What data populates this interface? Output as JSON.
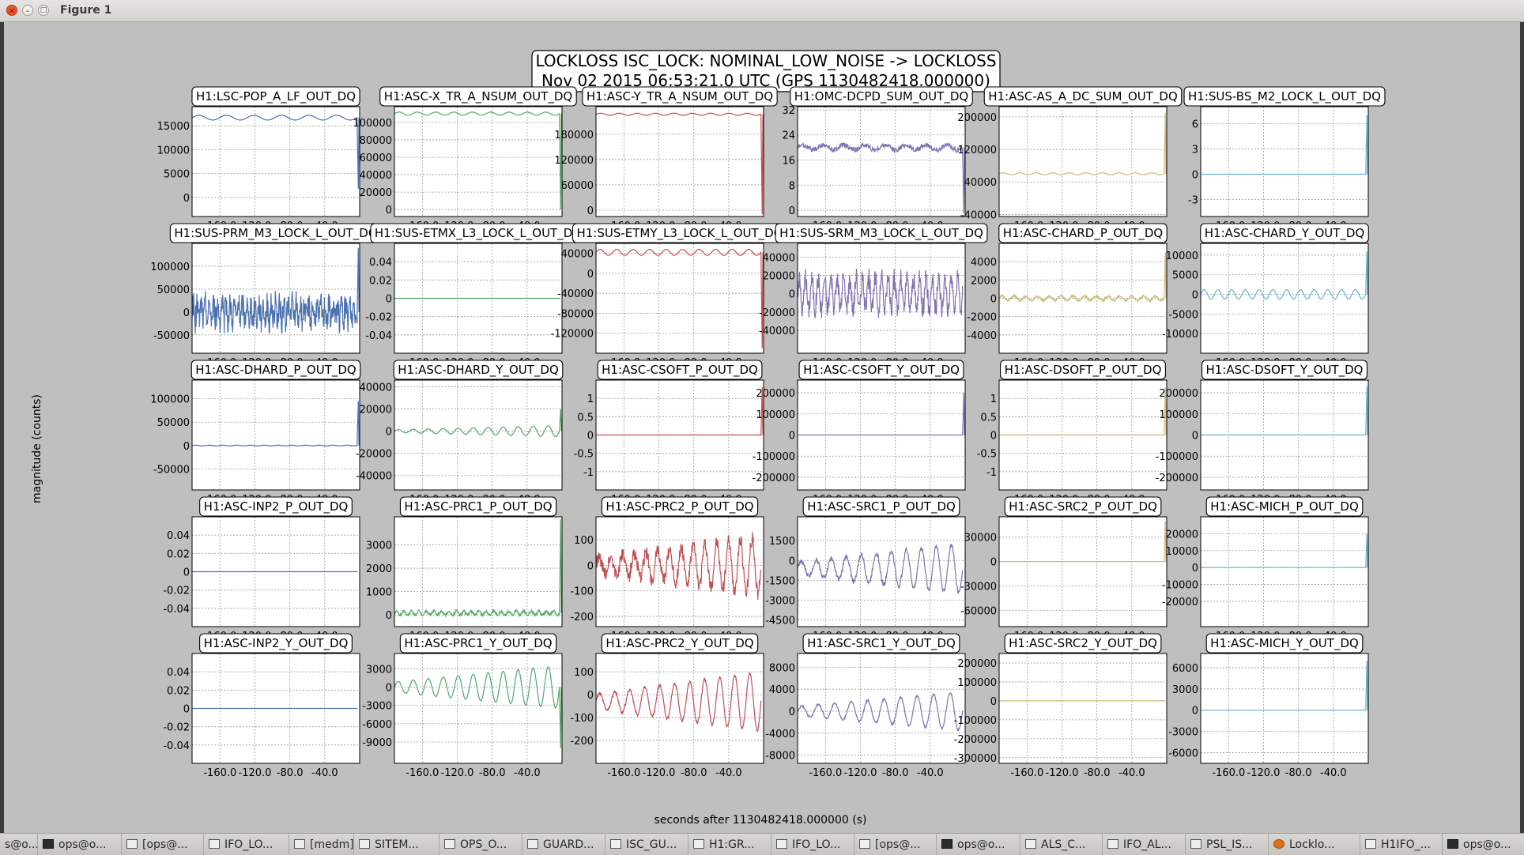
{
  "window": {
    "title": "Figure 1"
  },
  "figure": {
    "title_line1": "LOCKLOSS ISC_LOCK: NOMINAL_LOW_NOISE -> LOCKLOSS",
    "title_line2": "Nov 02 2015 06:53:21.0 UTC (GPS 1130482418.000000)",
    "xlabel": "seconds after 1130482418.000000 (s)",
    "ylabel": "magnitude (counts)"
  },
  "colors": [
    "#4c72b0",
    "#55a868",
    "#c44e52",
    "#8172b2",
    "#ccb974",
    "#64b5cd"
  ],
  "chart_data": [
    {
      "type": "line",
      "title": "H1:LSC-POP_A_LF_OUT_DQ",
      "x_range": [
        -192,
        0
      ],
      "ylim": [
        -4000,
        19000
      ],
      "yticks": [
        0,
        5000,
        10000,
        15000
      ],
      "xticks": [
        -160,
        -120,
        -80,
        -40
      ],
      "series": [
        {
          "shape": "sine",
          "base": 16700,
          "amp": 500,
          "periods": 6,
          "end": "drop",
          "end_y": 1800
        }
      ]
    },
    {
      "type": "line",
      "title": "H1:ASC-X_TR_A_NSUM_OUT_DQ",
      "x_range": [
        -192,
        0
      ],
      "ylim": [
        -8000,
        118000
      ],
      "yticks": [
        0,
        20000,
        40000,
        60000,
        80000,
        100000
      ],
      "xticks": [
        -160,
        -120,
        -80,
        -40
      ],
      "series": [
        {
          "shape": "sine",
          "base": 110000,
          "amp": 1800,
          "periods": 9,
          "end": "drop",
          "end_y": 0
        }
      ]
    },
    {
      "type": "line",
      "title": "H1:ASC-Y_TR_A_NSUM_OUT_DQ",
      "x_range": [
        -192,
        0
      ],
      "ylim": [
        -15000,
        245000
      ],
      "yticks": [
        0,
        60000,
        120000,
        180000
      ],
      "xticks": [
        -160,
        -120,
        -80,
        -40
      ],
      "series": [
        {
          "shape": "sine",
          "base": 227000,
          "amp": 2500,
          "periods": 9,
          "end": "drop",
          "end_y": -10000
        }
      ]
    },
    {
      "type": "line",
      "title": "H1:OMC-DCPD_SUM_OUT_DQ",
      "x_range": [
        -192,
        0
      ],
      "ylim": [
        -2,
        33
      ],
      "yticks": [
        0,
        8,
        16,
        24,
        32
      ],
      "xticks": [
        -160,
        -120,
        -80,
        -40
      ],
      "series": [
        {
          "shape": "band",
          "base": 20,
          "amp": 0.8,
          "periods": 8,
          "noise": 1,
          "end": "drop",
          "end_y": -1
        }
      ]
    },
    {
      "type": "line",
      "title": "H1:ASC-AS_A_DC_SUM_OUT_DQ",
      "x_range": [
        -192,
        0
      ],
      "ylim": [
        -45000,
        225000
      ],
      "yticks": [
        -40000,
        40000,
        120000,
        200000
      ],
      "xticks": [
        -160,
        -120,
        -80,
        -40
      ],
      "series": [
        {
          "shape": "sine",
          "base": 60000,
          "amp": 2500,
          "periods": 10,
          "end": "spike",
          "end_y": 210000
        }
      ]
    },
    {
      "type": "line",
      "title": "H1:SUS-BS_M2_LOCK_L_OUT_DQ",
      "x_range": [
        -192,
        0
      ],
      "ylim": [
        -5,
        8
      ],
      "yticks": [
        -3,
        0,
        3,
        6
      ],
      "xticks": [
        -160,
        -120,
        -80,
        -40
      ],
      "series": [
        {
          "shape": "flat",
          "base": 0,
          "amp": 0,
          "periods": 1,
          "end": "spike",
          "end_y": 7
        }
      ]
    },
    {
      "type": "line",
      "title": "H1:SUS-PRM_M3_LOCK_L_OUT_DQ",
      "x_range": [
        -192,
        0
      ],
      "ylim": [
        -90000,
        150000
      ],
      "yticks": [
        -50000,
        0,
        50000,
        100000
      ],
      "xticks": [
        -160,
        -120,
        -80,
        -40
      ],
      "series": [
        {
          "shape": "noise",
          "base": 0,
          "amp": 30000,
          "periods": 40,
          "noise": 1,
          "end": "spike",
          "end_y": 140000
        }
      ]
    },
    {
      "type": "line",
      "title": "H1:SUS-ETMX_L3_LOCK_L_OUT_DQ",
      "x_range": [
        -192,
        0
      ],
      "ylim": [
        -0.06,
        0.06
      ],
      "yticks": [
        -0.04,
        -0.02,
        0,
        0.02,
        0.04
      ],
      "xticks": [
        -160,
        -120,
        -80,
        -40
      ],
      "series": [
        {
          "shape": "flat",
          "base": 0,
          "amp": 0,
          "periods": 1,
          "end": "none",
          "end_y": 0
        }
      ]
    },
    {
      "type": "line",
      "title": "H1:SUS-ETMY_L3_LOCK_L_OUT_DQ",
      "x_range": [
        -192,
        0
      ],
      "ylim": [
        -160000,
        60000
      ],
      "yticks": [
        -120000,
        -80000,
        -40000,
        0,
        40000
      ],
      "xticks": [
        -160,
        -120,
        -80,
        -40
      ],
      "series": [
        {
          "shape": "sine",
          "base": 42000,
          "amp": 6000,
          "periods": 10,
          "end": "drop",
          "end_y": -150000
        }
      ]
    },
    {
      "type": "line",
      "title": "H1:SUS-SRM_M3_LOCK_L_OUT_DQ",
      "x_range": [
        -192,
        0
      ],
      "ylim": [
        -65000,
        55000
      ],
      "yticks": [
        -40000,
        -20000,
        0,
        20000,
        40000
      ],
      "xticks": [
        -160,
        -120,
        -80,
        -40
      ],
      "series": [
        {
          "shape": "noise",
          "base": 0,
          "amp": 28000,
          "periods": 26,
          "noise": 0.4,
          "end": "none",
          "end_y": 0
        }
      ]
    },
    {
      "type": "line",
      "title": "H1:ASC-CHARD_P_OUT_DQ",
      "x_range": [
        -192,
        0
      ],
      "ylim": [
        -6000,
        6000
      ],
      "yticks": [
        -4000,
        -2000,
        0,
        2000,
        4000
      ],
      "xticks": [
        -160,
        -120,
        -80,
        -40
      ],
      "series": [
        {
          "shape": "band",
          "base": 0,
          "amp": 250,
          "periods": 14,
          "noise": 0.5,
          "end": "spike",
          "end_y": 5000
        }
      ]
    },
    {
      "type": "line",
      "title": "H1:ASC-CHARD_Y_OUT_DQ",
      "x_range": [
        -192,
        0
      ],
      "ylim": [
        -15000,
        13000
      ],
      "yticks": [
        -10000,
        -5000,
        0,
        5000,
        10000
      ],
      "xticks": [
        -160,
        -120,
        -80,
        -40
      ],
      "series": [
        {
          "shape": "sine",
          "base": 0,
          "amp": 1200,
          "periods": 12,
          "end": "spike",
          "end_y": 11000
        }
      ]
    },
    {
      "type": "line",
      "title": "H1:ASC-DHARD_P_OUT_DQ",
      "x_range": [
        -192,
        0
      ],
      "ylim": [
        -95000,
        140000
      ],
      "yticks": [
        -50000,
        0,
        50000,
        100000
      ],
      "xticks": [
        -160,
        -120,
        -80,
        -40
      ],
      "series": [
        {
          "shape": "sine",
          "base": 0,
          "amp": 800,
          "periods": 12,
          "end": "spike",
          "end_y": 95000
        }
      ]
    },
    {
      "type": "line",
      "title": "H1:ASC-DHARD_Y_OUT_DQ",
      "x_range": [
        -192,
        0
      ],
      "ylim": [
        -53000,
        46000
      ],
      "yticks": [
        -40000,
        -20000,
        0,
        20000,
        40000
      ],
      "xticks": [
        -160,
        -120,
        -80,
        -40
      ],
      "series": [
        {
          "shape": "growsine",
          "base": 0,
          "amp": 5000,
          "periods": 11,
          "end": "spike",
          "end_y": 20000
        }
      ]
    },
    {
      "type": "line",
      "title": "H1:ASC-CSOFT_P_OUT_DQ",
      "x_range": [
        -192,
        0
      ],
      "ylim": [
        -1.5,
        1.5
      ],
      "yticks": [
        -1,
        -0.5,
        0,
        0.5,
        1
      ],
      "xticks": [
        -160,
        -120,
        -80,
        -40
      ],
      "series": [
        {
          "shape": "flat",
          "base": 0,
          "amp": 0,
          "periods": 1,
          "end": "spike",
          "end_y": 1.3
        }
      ]
    },
    {
      "type": "line",
      "title": "H1:ASC-CSOFT_Y_OUT_DQ",
      "x_range": [
        -192,
        0
      ],
      "ylim": [
        -260000,
        260000
      ],
      "yticks": [
        -200000,
        -100000,
        0,
        100000,
        200000
      ],
      "xticks": [
        -160,
        -120,
        -80,
        -40
      ],
      "series": [
        {
          "shape": "flat",
          "base": 0,
          "amp": 0,
          "periods": 1,
          "end": "spike",
          "end_y": 200000
        }
      ]
    },
    {
      "type": "line",
      "title": "H1:ASC-DSOFT_P_OUT_DQ",
      "x_range": [
        -192,
        0
      ],
      "ylim": [
        -1.5,
        1.5
      ],
      "yticks": [
        -1,
        -0.5,
        0,
        0.5,
        1
      ],
      "xticks": [
        -160,
        -120,
        -80,
        -40
      ],
      "series": [
        {
          "shape": "flat",
          "base": 0,
          "amp": 0,
          "periods": 1,
          "end": "spike",
          "end_y": 1.3
        }
      ]
    },
    {
      "type": "line",
      "title": "H1:ASC-DSOFT_Y_OUT_DQ",
      "x_range": [
        -192,
        0
      ],
      "ylim": [
        -260000,
        260000
      ],
      "yticks": [
        -200000,
        -100000,
        0,
        100000,
        200000
      ],
      "xticks": [
        -160,
        -120,
        -80,
        -40
      ],
      "series": [
        {
          "shape": "flat",
          "base": 0,
          "amp": 0,
          "periods": 1,
          "end": "spike",
          "end_y": 230000
        }
      ]
    },
    {
      "type": "line",
      "title": "H1:ASC-INP2_P_OUT_DQ",
      "x_range": [
        -192,
        0
      ],
      "ylim": [
        -0.06,
        0.06
      ],
      "yticks": [
        -0.04,
        -0.02,
        0,
        0.02,
        0.04
      ],
      "xticks": [
        -160,
        -120,
        -80,
        -40
      ],
      "series": [
        {
          "shape": "flat",
          "base": 0,
          "amp": 0,
          "periods": 1,
          "end": "none",
          "end_y": 0
        }
      ]
    },
    {
      "type": "line",
      "title": "H1:ASC-PRC1_P_OUT_DQ",
      "x_range": [
        -192,
        0
      ],
      "ylim": [
        -500,
        4200
      ],
      "yticks": [
        0,
        1000,
        2000,
        3000
      ],
      "xticks": [
        -160,
        -120,
        -80,
        -40
      ],
      "series": [
        {
          "shape": "band",
          "base": 80,
          "amp": 80,
          "periods": 22,
          "noise": 0.8,
          "end": "spike",
          "end_y": 4100
        }
      ]
    },
    {
      "type": "line",
      "title": "H1:ASC-PRC2_P_OUT_DQ",
      "x_range": [
        -192,
        0
      ],
      "ylim": [
        -240,
        190
      ],
      "yticks": [
        -200,
        -100,
        0,
        100
      ],
      "xticks": [
        -160,
        -120,
        -80,
        -40
      ],
      "series": [
        {
          "shape": "growsine",
          "base": 0,
          "amp": 110,
          "periods": 14,
          "noise": 0.5,
          "end": "none",
          "end_y": 0
        }
      ]
    },
    {
      "type": "line",
      "title": "H1:ASC-SRC1_P_OUT_DQ",
      "x_range": [
        -192,
        0
      ],
      "ylim": [
        -5000,
        3300
      ],
      "yticks": [
        -4500,
        -3000,
        -1500,
        0,
        1500
      ],
      "xticks": [
        -160,
        -120,
        -80,
        -40
      ],
      "series": [
        {
          "shape": "growsine",
          "base": -600,
          "amp": 1900,
          "periods": 11,
          "noise": 0.2,
          "end": "none",
          "end_y": 0
        }
      ]
    },
    {
      "type": "line",
      "title": "H1:ASC-SRC2_P_OUT_DQ",
      "x_range": [
        -192,
        0
      ],
      "ylim": [
        -80000,
        55000
      ],
      "yticks": [
        -60000,
        -30000,
        0,
        30000
      ],
      "xticks": [
        -160,
        -120,
        -80,
        -40
      ],
      "series": [
        {
          "shape": "flat",
          "base": 0,
          "amp": 0,
          "periods": 1,
          "end": "spike",
          "end_y": 50000
        }
      ]
    },
    {
      "type": "line",
      "title": "H1:ASC-MICH_P_OUT_DQ",
      "x_range": [
        -192,
        0
      ],
      "ylim": [
        -35000,
        30000
      ],
      "yticks": [
        -20000,
        -10000,
        0,
        10000,
        20000
      ],
      "xticks": [
        -160,
        -120,
        -80,
        -40
      ],
      "series": [
        {
          "shape": "flat",
          "base": 0,
          "amp": 0,
          "periods": 1,
          "end": "spike",
          "end_y": 20000
        }
      ]
    },
    {
      "type": "line",
      "title": "H1:ASC-INP2_Y_OUT_DQ",
      "x_range": [
        -192,
        0
      ],
      "ylim": [
        -0.06,
        0.06
      ],
      "yticks": [
        -0.04,
        -0.02,
        0,
        0.02,
        0.04
      ],
      "xticks": [
        -160,
        -120,
        -80,
        -40
      ],
      "series": [
        {
          "shape": "flat",
          "base": 0,
          "amp": 0,
          "periods": 1,
          "end": "none",
          "end_y": 0
        }
      ]
    },
    {
      "type": "line",
      "title": "H1:ASC-PRC1_Y_OUT_DQ",
      "x_range": [
        -192,
        0
      ],
      "ylim": [
        -12500,
        5500
      ],
      "yticks": [
        -9000,
        -6000,
        -3000,
        0,
        3000
      ],
      "xticks": [
        -160,
        -120,
        -80,
        -40
      ],
      "series": [
        {
          "shape": "growsine",
          "base": 0,
          "amp": 3500,
          "periods": 11,
          "end": "drop",
          "end_y": -10000
        }
      ]
    },
    {
      "type": "line",
      "title": "H1:ASC-PRC2_Y_OUT_DQ",
      "x_range": [
        -192,
        0
      ],
      "ylim": [
        -300,
        180
      ],
      "yticks": [
        -200,
        -100,
        0,
        100
      ],
      "xticks": [
        -160,
        -120,
        -80,
        -40
      ],
      "series": [
        {
          "shape": "growsine",
          "base": -30,
          "amp": 130,
          "periods": 11,
          "noise": 0.1,
          "end": "none",
          "end_y": 0
        }
      ]
    },
    {
      "type": "line",
      "title": "H1:ASC-SRC1_Y_OUT_DQ",
      "x_range": [
        -192,
        0
      ],
      "ylim": [
        -9500,
        10500
      ],
      "yticks": [
        -8000,
        -4000,
        0,
        4000,
        8000
      ],
      "xticks": [
        -160,
        -120,
        -80,
        -40
      ],
      "series": [
        {
          "shape": "growsine",
          "base": 0,
          "amp": 3500,
          "periods": 10,
          "noise": 0.1,
          "end": "none",
          "end_y": 0
        }
      ]
    },
    {
      "type": "line",
      "title": "H1:ASC-SRC2_Y_OUT_DQ",
      "x_range": [
        -192,
        0
      ],
      "ylim": [
        -330000,
        250000
      ],
      "yticks": [
        -300000,
        -200000,
        -100000,
        0,
        100000,
        200000
      ],
      "xticks": [
        -160,
        -120,
        -80,
        -40
      ],
      "series": [
        {
          "shape": "flat",
          "base": 0,
          "amp": 0,
          "periods": 1,
          "end": "none",
          "end_y": 0
        }
      ]
    },
    {
      "type": "line",
      "title": "H1:ASC-MICH_Y_OUT_DQ",
      "x_range": [
        -192,
        0
      ],
      "ylim": [
        -7500,
        8000
      ],
      "yticks": [
        -6000,
        -3000,
        0,
        3000,
        6000
      ],
      "xticks": [
        -160,
        -120,
        -80,
        -40
      ],
      "series": [
        {
          "shape": "flat",
          "base": 0,
          "amp": 0,
          "periods": 1,
          "end": "spike",
          "end_y": 7000
        }
      ]
    }
  ],
  "taskbar": [
    {
      "label": "s@o...",
      "icon": "terminal-icon"
    },
    {
      "label": "ops@o...",
      "icon": "terminal-icon"
    },
    {
      "label": "[ops@...",
      "icon": "window-icon"
    },
    {
      "label": "IFO_LO...",
      "icon": "window-icon"
    },
    {
      "label": "[medm]",
      "icon": "window-icon"
    },
    {
      "label": "SITEM...",
      "icon": "window-icon"
    },
    {
      "label": "OPS_O...",
      "icon": "window-icon"
    },
    {
      "label": "GUARD...",
      "icon": "window-icon"
    },
    {
      "label": "ISC_GU...",
      "icon": "window-icon"
    },
    {
      "label": "H1:GR...",
      "icon": "window-icon"
    },
    {
      "label": "IFO_LO...",
      "icon": "window-icon"
    },
    {
      "label": "[ops@...",
      "icon": "window-icon"
    },
    {
      "label": "ops@o...",
      "icon": "terminal-icon"
    },
    {
      "label": "ALS_C...",
      "icon": "window-icon"
    },
    {
      "label": "IFO_AL...",
      "icon": "window-icon"
    },
    {
      "label": "PSL_IS...",
      "icon": "window-icon"
    },
    {
      "label": "Locklo...",
      "icon": "firefox-icon"
    },
    {
      "label": "H1IFO_...",
      "icon": "window-icon"
    },
    {
      "label": "ops@o...",
      "icon": "terminal-icon"
    }
  ]
}
